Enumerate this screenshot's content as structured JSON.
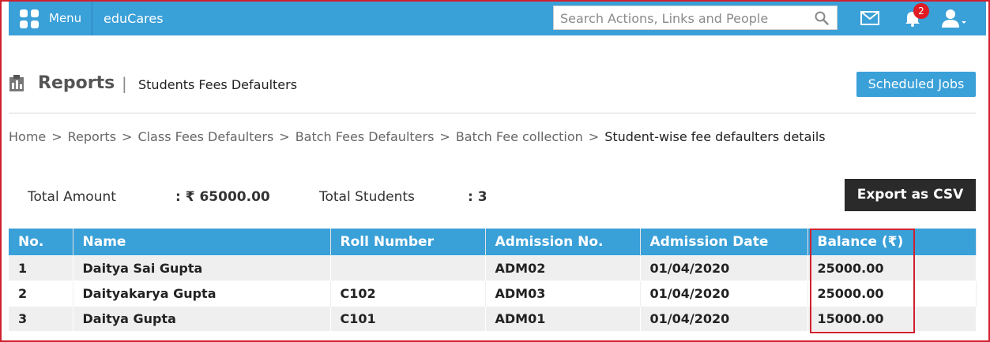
{
  "topbar": {
    "menu_label": "Menu",
    "app_name": "eduCares",
    "search_placeholder": "Search Actions, Links and People",
    "notification_count": "2"
  },
  "header": {
    "title": "Reports",
    "separator": "|",
    "subtitle": "Students Fees Defaulters",
    "scheduled_jobs_label": "Scheduled Jobs"
  },
  "breadcrumb": {
    "items": [
      "Home",
      "Reports",
      "Class Fees Defaulters",
      "Batch Fees Defaulters",
      "Batch Fee collection"
    ],
    "separator": ">",
    "current": "Student-wise fee defaulters details"
  },
  "summary": {
    "total_amount_label": "Total Amount",
    "total_amount_value": ": ₹ 65000.00",
    "total_students_label": "Total Students",
    "total_students_value": ": 3"
  },
  "export_label": "Export as CSV",
  "table": {
    "headers": [
      "No.",
      "Name",
      "Roll Number",
      "Admission No.",
      "Admission Date",
      "Balance (₹)"
    ],
    "rows": [
      [
        "1",
        "Daitya Sai Gupta",
        "",
        "ADM02",
        "01/04/2020",
        "25000.00"
      ],
      [
        "2",
        "Daityakarya Gupta",
        "C102",
        "ADM03",
        "01/04/2020",
        "25000.00"
      ],
      [
        "3",
        "Daitya Gupta",
        "C101",
        "ADM01",
        "01/04/2020",
        "15000.00"
      ]
    ]
  },
  "colors": {
    "accent": "#3aa0d8",
    "highlight": "#d0202e",
    "dark_button": "#2a2a2a"
  }
}
